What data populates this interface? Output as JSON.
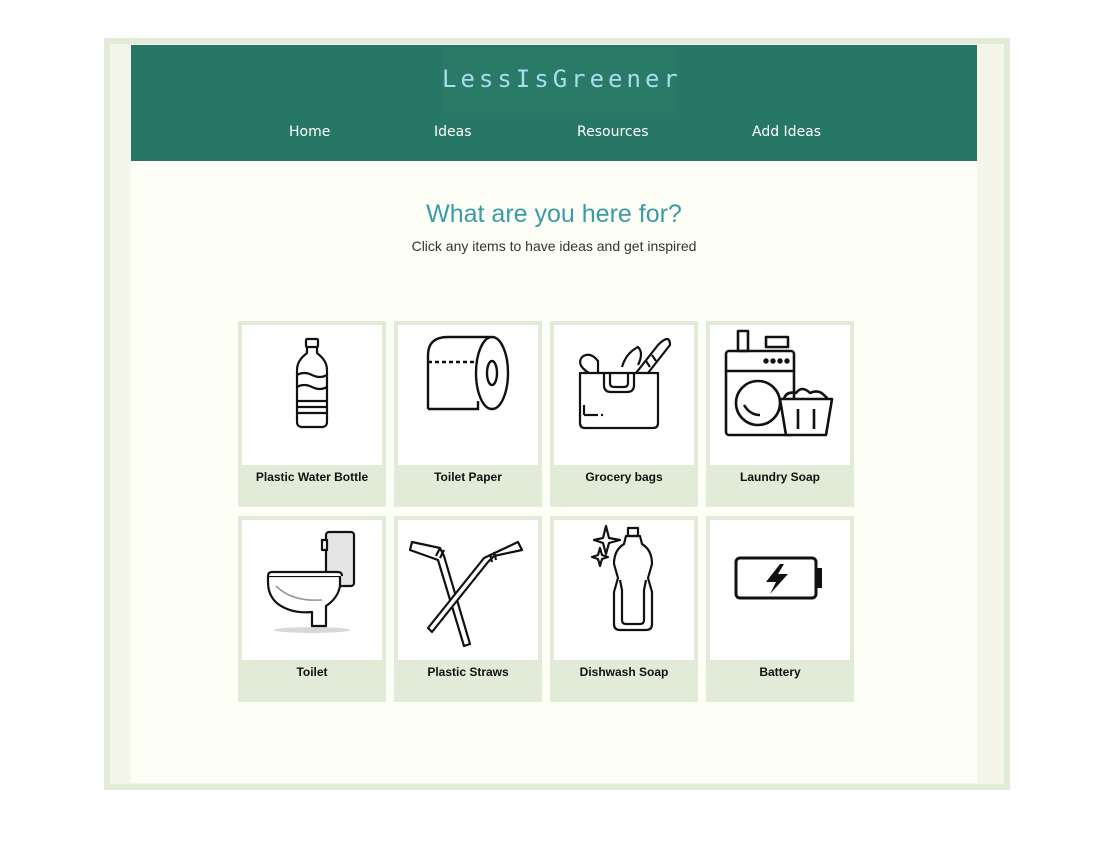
{
  "site": {
    "logo_text": "LessIsGreener"
  },
  "nav": {
    "items": [
      {
        "label": "Home"
      },
      {
        "label": "Ideas"
      },
      {
        "label": "Resources"
      },
      {
        "label": "Add Ideas"
      }
    ]
  },
  "hero": {
    "title": "What are you here for?",
    "subtitle": "Click any items to have ideas and get inspired"
  },
  "items": [
    {
      "label": "Plastic Water Bottle",
      "icon": "water-bottle-icon"
    },
    {
      "label": "Toilet Paper",
      "icon": "toilet-paper-icon"
    },
    {
      "label": "Grocery bags",
      "icon": "grocery-bag-icon"
    },
    {
      "label": "Laundry Soap",
      "icon": "washing-machine-icon"
    },
    {
      "label": "Toilet",
      "icon": "toilet-icon"
    },
    {
      "label": "Plastic Straws",
      "icon": "straws-icon"
    },
    {
      "label": "Dishwash Soap",
      "icon": "dish-soap-icon"
    },
    {
      "label": "Battery",
      "icon": "battery-icon"
    }
  ],
  "colors": {
    "header_bg": "#267765",
    "logo_text": "#a7dcee",
    "title": "#3a9ba6",
    "page_bg": "#fdfef5",
    "card_bg": "#e2ebd7"
  }
}
